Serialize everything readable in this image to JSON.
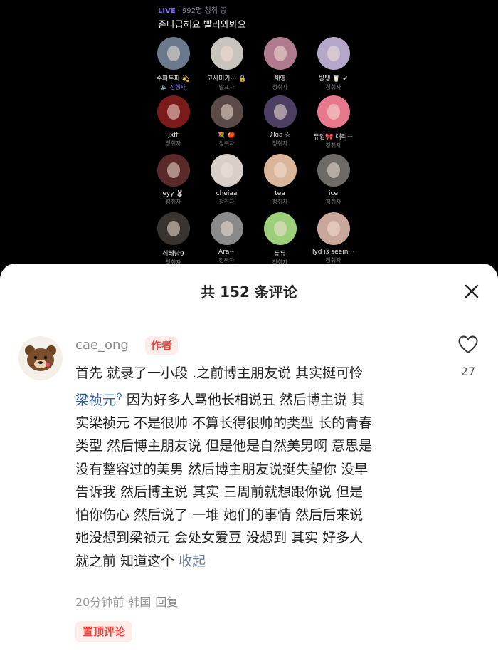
{
  "live": {
    "tag": "LIVE",
    "viewers": "· 992명 청취 중",
    "title": "존나급해요 빨리와봐요",
    "members": [
      {
        "name": "수파두파 💫",
        "role": "🔈 진행자",
        "host": true,
        "color": "#6a7a8c"
      },
      {
        "name": "고사미가··· 🔒",
        "role": "발표자",
        "host": false,
        "color": "#c9c4bd"
      },
      {
        "name": "채영",
        "role": "청취자",
        "host": false,
        "color": "#b07a8e"
      },
      {
        "name": "방탱 🥛 ✔",
        "role": "청취자",
        "host": false,
        "color": "#b4a7c9"
      },
      {
        "name": "jxff",
        "role": "청취자",
        "host": false,
        "color": "#7a1a1a"
      },
      {
        "name": "💐 🍎",
        "role": "청취자",
        "host": false,
        "color": "#5a4a48"
      },
      {
        "name": "♪kia ☆",
        "role": "청취자",
        "host": false,
        "color": "#4c3f63"
      },
      {
        "name": "듀잉🎀 대리···",
        "role": "청취자",
        "host": false,
        "color": "#e8788e"
      },
      {
        "name": "eyy 🐰",
        "role": "청취자",
        "host": false,
        "color": "#5a2a2a"
      },
      {
        "name": "cheiaa",
        "role": "청취자",
        "host": false,
        "color": "#d8cfc8"
      },
      {
        "name": "tea",
        "role": "청취자",
        "host": false,
        "color": "#d9b59a"
      },
      {
        "name": "ice",
        "role": "청취자",
        "host": false,
        "color": "#6e6a66"
      },
      {
        "name": "심혜냥9",
        "role": "청취자",
        "host": false,
        "color": "#3a3430"
      },
      {
        "name": "Ara~",
        "role": "청취자",
        "host": false,
        "color": "#8a8a8a"
      },
      {
        "name": "듀듀",
        "role": "청취자",
        "host": false,
        "color": "#9ccf7a"
      },
      {
        "name": "lyd is seein···",
        "role": "청취자",
        "host": false,
        "color": "#c9a79a"
      }
    ]
  },
  "sheet": {
    "title": "共 152 条评论",
    "comment": {
      "username": "cae_ong",
      "author_badge": "作者",
      "likes": "27",
      "lines": [
        {
          "text": "首先 就录了一小段 .之前博主朋友说 其实挺可怜"
        },
        {
          "link": "梁祯元",
          "text": " 因为好多人骂他长相说丑 然后博主说 其"
        },
        {
          "text": "实梁祯元 不是很帅 不算长得很帅的类型 长的青春"
        },
        {
          "text": "类型 然后博主朋友说 但是他是自然美男啊 意思是"
        },
        {
          "text": "没有整容过的美男 然后博主朋友说挺失望你 没早"
        },
        {
          "text": "告诉我 然后博主说 其实 三周前就想跟你说 但是"
        },
        {
          "text": "怕你伤心 然后说了 一堆 她们的事情 然后后来说"
        },
        {
          "text": "她没想到梁祯元 会处女爱豆 没想到 其实 好多人"
        },
        {
          "text": "就之前 知道这个",
          "collapse": "收起"
        }
      ],
      "time": "20分钟前",
      "location": "韩国",
      "reply": "回复",
      "pinned": "置顶评论"
    }
  },
  "colors": {
    "accent_red": "#e8453c",
    "link_blue": "#2a5fa8",
    "live_purple": "#7b6cff"
  }
}
